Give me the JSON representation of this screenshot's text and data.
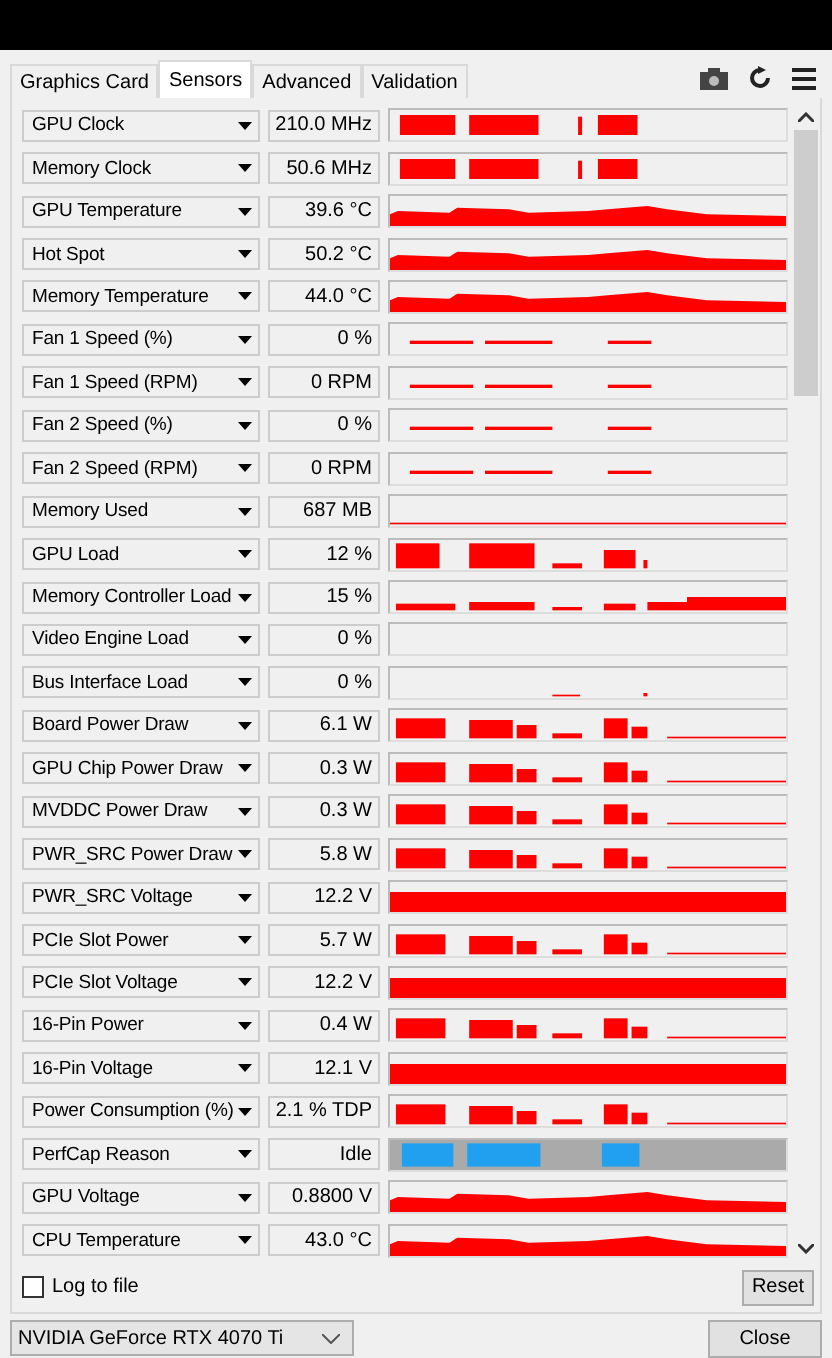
{
  "tabs": [
    {
      "label": "Graphics Card",
      "selected": false
    },
    {
      "label": "Sensors",
      "selected": true
    },
    {
      "label": "Advanced",
      "selected": false
    },
    {
      "label": "Validation",
      "selected": false
    }
  ],
  "sensors": [
    {
      "name": "GPU Clock",
      "value": "210.0 MHz",
      "kind": "blocks"
    },
    {
      "name": "Memory Clock",
      "value": "50.6 MHz",
      "kind": "blocks"
    },
    {
      "name": "GPU Temperature",
      "value": "39.6 °C",
      "kind": "profile"
    },
    {
      "name": "Hot Spot",
      "value": "50.2 °C",
      "kind": "profile"
    },
    {
      "name": "Memory Temperature",
      "value": "44.0 °C",
      "kind": "profile"
    },
    {
      "name": "Fan 1 Speed (%)",
      "value": "0 %",
      "kind": "fan"
    },
    {
      "name": "Fan 1 Speed (RPM)",
      "value": "0 RPM",
      "kind": "fan"
    },
    {
      "name": "Fan 2 Speed (%)",
      "value": "0 %",
      "kind": "fan"
    },
    {
      "name": "Fan 2 Speed (RPM)",
      "value": "0 RPM",
      "kind": "fan"
    },
    {
      "name": "Memory Used",
      "value": "687 MB",
      "kind": "line"
    },
    {
      "name": "GPU Load",
      "value": "12 %",
      "kind": "load"
    },
    {
      "name": "Memory Controller Load",
      "value": "15 %",
      "kind": "mcload"
    },
    {
      "name": "Video Engine Load",
      "value": "0 %",
      "kind": "empty"
    },
    {
      "name": "Bus Interface Load",
      "value": "0 %",
      "kind": "tiny"
    },
    {
      "name": "Board Power Draw",
      "value": "6.1 W",
      "kind": "power"
    },
    {
      "name": "GPU Chip Power Draw",
      "value": "0.3 W",
      "kind": "power"
    },
    {
      "name": "MVDDC Power Draw",
      "value": "0.3 W",
      "kind": "power"
    },
    {
      "name": "PWR_SRC Power Draw",
      "value": "5.8 W",
      "kind": "power"
    },
    {
      "name": "PWR_SRC Voltage",
      "value": "12.2 V",
      "kind": "full"
    },
    {
      "name": "PCIe Slot Power",
      "value": "5.7 W",
      "kind": "power"
    },
    {
      "name": "PCIe Slot Voltage",
      "value": "12.2 V",
      "kind": "full"
    },
    {
      "name": "16-Pin Power",
      "value": "0.4 W",
      "kind": "power"
    },
    {
      "name": "16-Pin Voltage",
      "value": "12.1 V",
      "kind": "full"
    },
    {
      "name": "Power Consumption (%)",
      "value": "2.1 % TDP",
      "kind": "power"
    },
    {
      "name": "PerfCap Reason",
      "value": "Idle",
      "kind": "perfcap"
    },
    {
      "name": "GPU Voltage",
      "value": "0.8800 V",
      "kind": "profile"
    },
    {
      "name": "CPU Temperature",
      "value": "43.0 °C",
      "kind": "profile"
    }
  ],
  "log_to_file": {
    "label": "Log to file",
    "checked": false
  },
  "reset_button": "Reset",
  "gpu_select": "NVIDIA GeForce RTX 4070 Ti",
  "close_button": "Close"
}
